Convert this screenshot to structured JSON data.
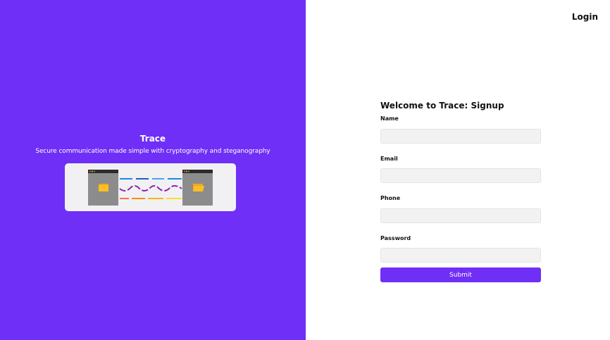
{
  "nav": {
    "login_label": "Login"
  },
  "brand": {
    "title": "Trace",
    "tagline": "Secure communication made simple with cryptography and steganography"
  },
  "illustration": {
    "left_icon": "folder-icon",
    "right_icon": "folder-icon"
  },
  "signup": {
    "title": "Welcome to Trace: Signup",
    "fields": [
      {
        "label": "Name",
        "value": "",
        "placeholder": ""
      },
      {
        "label": "Email",
        "value": "",
        "placeholder": ""
      },
      {
        "label": "Phone",
        "value": "",
        "placeholder": ""
      },
      {
        "label": "Password",
        "value": "",
        "placeholder": ""
      }
    ],
    "submit_label": "Submit"
  },
  "colors": {
    "brand": "#6f2ff7",
    "input_bg": "#f2f2f2",
    "folder": "#fbbf24"
  }
}
